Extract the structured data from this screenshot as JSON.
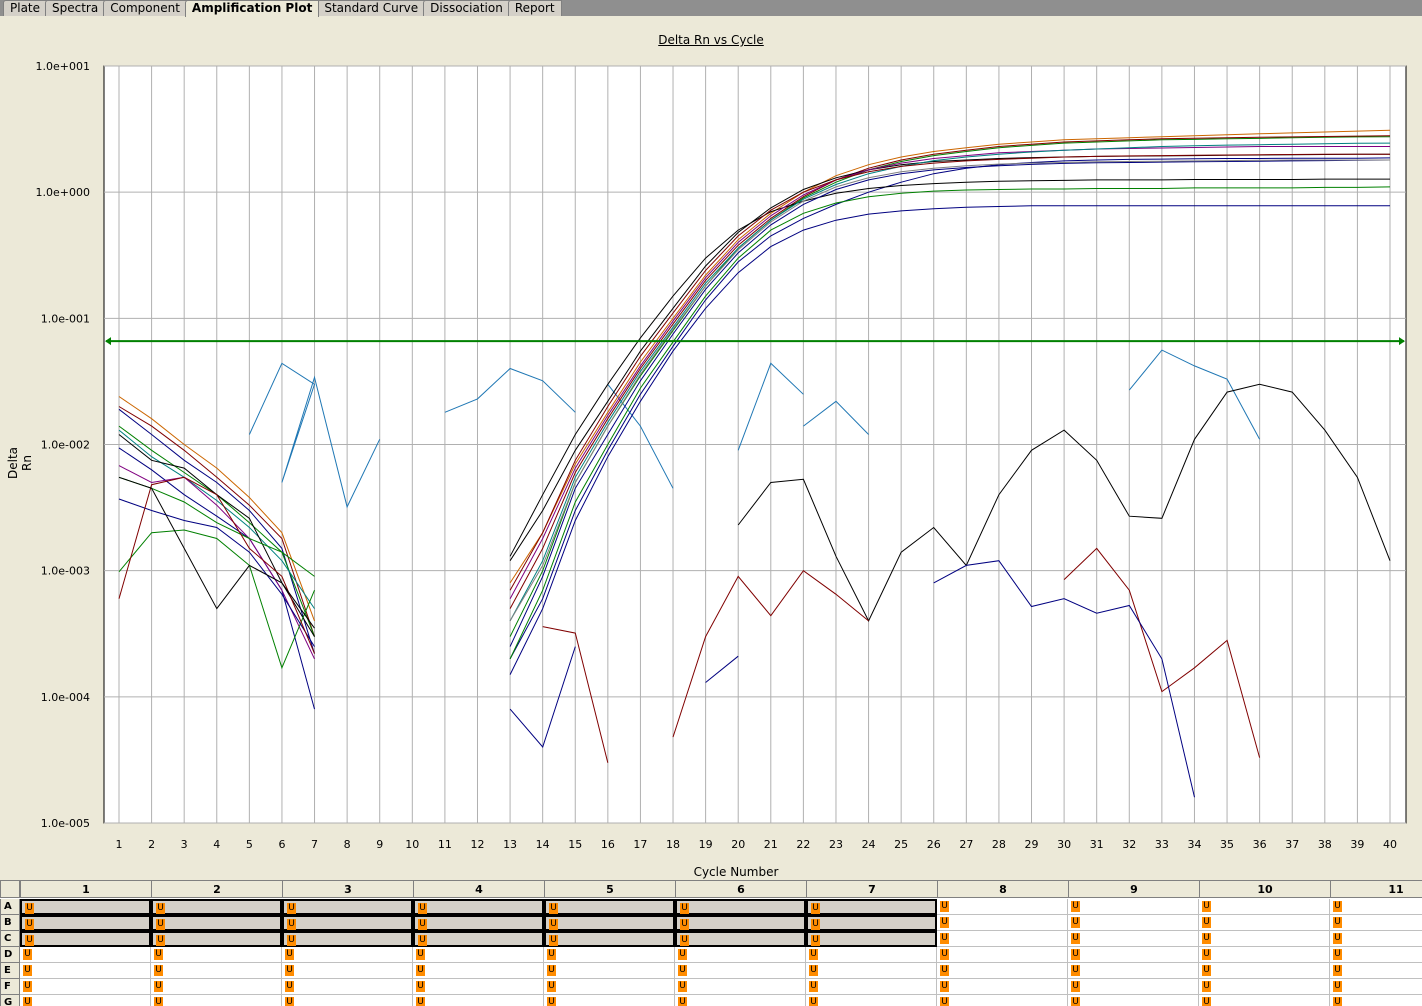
{
  "tabs": [
    "Plate",
    "Spectra",
    "Component",
    "Amplification Plot",
    "Standard Curve",
    "Dissociation",
    "Report"
  ],
  "active_tab": "Amplification Plot",
  "chart_data": {
    "type": "line",
    "title": "Delta Rn vs Cycle",
    "xlabel": "Cycle Number",
    "ylabel": "Delta Rn",
    "yscale": "log",
    "ylim": [
      1e-05,
      10
    ],
    "xlim": [
      1,
      40
    ],
    "y_tick_labels": [
      "1.0e+001",
      "1.0e+000",
      "1.0e-001",
      "1.0e-002",
      "1.0e-003",
      "1.0e-004",
      "1.0e-005"
    ],
    "x_tick_labels": [
      "1",
      "2",
      "3",
      "4",
      "5",
      "6",
      "7",
      "8",
      "9",
      "10",
      "11",
      "12",
      "13",
      "14",
      "15",
      "16",
      "17",
      "18",
      "19",
      "20",
      "21",
      "22",
      "23",
      "24",
      "25",
      "26",
      "27",
      "28",
      "29",
      "30",
      "31",
      "32",
      "33",
      "34",
      "35",
      "36",
      "37",
      "38",
      "39",
      "40"
    ],
    "grid": true,
    "threshold": 0.066,
    "threshold_color": "#008000",
    "amplification_curves": {
      "cycles": [
        13,
        14,
        15,
        16,
        17,
        18,
        19,
        20,
        21,
        22,
        23,
        24,
        25,
        26,
        27,
        28,
        29,
        30,
        31,
        32,
        33,
        34,
        35,
        36,
        37,
        38,
        39,
        40
      ],
      "series": [
        {
          "color": "#000080",
          "values": [
            0.0002,
            0.0006,
            0.003,
            0.009,
            0.025,
            0.06,
            0.14,
            0.28,
            0.45,
            0.62,
            0.8,
            1.0,
            1.2,
            1.4,
            1.55,
            1.65,
            1.72,
            1.77,
            1.8,
            1.82,
            1.83,
            1.84,
            1.85,
            1.85,
            1.86,
            1.86,
            1.86,
            1.87
          ]
        },
        {
          "color": "#000080",
          "values": [
            0.00015,
            0.0005,
            0.0025,
            0.008,
            0.022,
            0.055,
            0.12,
            0.23,
            0.37,
            0.5,
            0.6,
            0.67,
            0.71,
            0.74,
            0.76,
            0.77,
            0.78,
            0.78,
            0.78,
            0.78,
            0.78,
            0.78,
            0.78,
            0.78,
            0.78,
            0.78,
            0.78,
            0.78
          ]
        },
        {
          "color": "#008000",
          "values": [
            0.0002,
            0.0007,
            0.0035,
            0.01,
            0.028,
            0.065,
            0.15,
            0.3,
            0.5,
            0.68,
            0.82,
            0.92,
            0.98,
            1.02,
            1.04,
            1.05,
            1.06,
            1.06,
            1.07,
            1.07,
            1.07,
            1.08,
            1.08,
            1.08,
            1.08,
            1.09,
            1.09,
            1.1
          ]
        },
        {
          "color": "#008000",
          "values": [
            0.0003,
            0.001,
            0.005,
            0.014,
            0.035,
            0.08,
            0.18,
            0.36,
            0.6,
            0.9,
            1.2,
            1.5,
            1.75,
            1.95,
            2.1,
            2.25,
            2.35,
            2.45,
            2.5,
            2.55,
            2.6,
            2.62,
            2.65,
            2.67,
            2.7,
            2.72,
            2.74,
            2.75
          ]
        },
        {
          "color": "#800000",
          "values": [
            0.0005,
            0.0015,
            0.006,
            0.016,
            0.04,
            0.09,
            0.2,
            0.38,
            0.62,
            0.92,
            1.25,
            1.55,
            1.8,
            2.0,
            2.15,
            2.3,
            2.4,
            2.5,
            2.55,
            2.6,
            2.65,
            2.68,
            2.7,
            2.72,
            2.74,
            2.76,
            2.78,
            2.8
          ]
        },
        {
          "color": "#cc6600",
          "values": [
            0.0008,
            0.002,
            0.007,
            0.018,
            0.045,
            0.1,
            0.22,
            0.42,
            0.68,
            1.0,
            1.35,
            1.65,
            1.9,
            2.1,
            2.25,
            2.4,
            2.5,
            2.6,
            2.65,
            2.7,
            2.75,
            2.8,
            2.85,
            2.9,
            2.95,
            3.0,
            3.05,
            3.1
          ]
        },
        {
          "color": "#000000",
          "values": [
            0.0012,
            0.003,
            0.009,
            0.022,
            0.055,
            0.12,
            0.26,
            0.48,
            0.75,
            1.05,
            1.3,
            1.5,
            1.65,
            1.75,
            1.8,
            1.85,
            1.88,
            1.9,
            1.92,
            1.93,
            1.94,
            1.95,
            1.96,
            1.97,
            1.98,
            1.99,
            2.0,
            2.0
          ]
        },
        {
          "color": "#000000",
          "values": [
            0.0013,
            0.004,
            0.012,
            0.03,
            0.07,
            0.15,
            0.3,
            0.5,
            0.7,
            0.85,
            0.98,
            1.07,
            1.13,
            1.17,
            1.2,
            1.22,
            1.23,
            1.24,
            1.25,
            1.25,
            1.25,
            1.26,
            1.26,
            1.26,
            1.26,
            1.27,
            1.27,
            1.27
          ]
        },
        {
          "color": "#800080",
          "values": [
            0.0006,
            0.0018,
            0.0065,
            0.017,
            0.042,
            0.095,
            0.21,
            0.4,
            0.65,
            0.95,
            1.25,
            1.5,
            1.7,
            1.85,
            1.95,
            2.05,
            2.1,
            2.15,
            2.2,
            2.22,
            2.24,
            2.26,
            2.28,
            2.3,
            2.3,
            2.3,
            2.3,
            2.3
          ]
        },
        {
          "color": "#008080",
          "values": [
            0.0004,
            0.0012,
            0.0055,
            0.015,
            0.038,
            0.085,
            0.19,
            0.36,
            0.6,
            0.88,
            1.15,
            1.4,
            1.6,
            1.78,
            1.9,
            2.0,
            2.08,
            2.15,
            2.2,
            2.25,
            2.3,
            2.33,
            2.36,
            2.38,
            2.4,
            2.42,
            2.44,
            2.45
          ]
        },
        {
          "color": "#000080",
          "values": [
            0.00025,
            0.0009,
            0.0045,
            0.012,
            0.032,
            0.075,
            0.17,
            0.33,
            0.55,
            0.8,
            1.05,
            1.25,
            1.4,
            1.5,
            1.57,
            1.62,
            1.66,
            1.69,
            1.71,
            1.72,
            1.73,
            1.74,
            1.75,
            1.76,
            1.77,
            1.78,
            1.79,
            1.8
          ]
        },
        {
          "color": "#800000",
          "values": [
            0.0007,
            0.002,
            0.0075,
            0.02,
            0.05,
            0.11,
            0.24,
            0.45,
            0.72,
            1.0,
            1.25,
            1.45,
            1.6,
            1.7,
            1.77,
            1.82,
            1.86,
            1.9,
            1.92,
            1.94,
            1.95,
            1.96,
            1.97,
            1.98,
            1.99,
            2.0,
            2.0,
            2.0
          ]
        },
        {
          "color": "#808080",
          "values": [
            0.0004,
            0.0011,
            0.005,
            0.014,
            0.036,
            0.082,
            0.18,
            0.35,
            0.58,
            0.85,
            1.1,
            1.3,
            1.45,
            1.55,
            1.62,
            1.67,
            1.7,
            1.72,
            1.74,
            1.75,
            1.76,
            1.77,
            1.78,
            1.79,
            1.8,
            1.8,
            1.8,
            1.8
          ]
        }
      ]
    },
    "noise_traces": [
      {
        "color": "#1f77b4",
        "points": [
          [
            5,
            0.012
          ],
          [
            6,
            0.044
          ],
          [
            7,
            0.03
          ],
          [
            6,
            0.005
          ],
          [
            7,
            0.034
          ],
          [
            8,
            0.0032
          ],
          [
            9,
            0.011
          ]
        ]
      },
      {
        "color": "#1f77b4",
        "points": [
          [
            11,
            0.018
          ],
          [
            12,
            0.023
          ],
          [
            13,
            0.04
          ],
          [
            14,
            0.032
          ],
          [
            15,
            0.018
          ]
        ]
      },
      {
        "color": "#1f77b4",
        "points": [
          [
            16,
            0.03
          ],
          [
            17,
            0.014
          ],
          [
            18,
            0.0045
          ]
        ]
      },
      {
        "color": "#1f77b4",
        "points": [
          [
            20,
            0.009
          ],
          [
            21,
            0.044
          ],
          [
            22,
            0.025
          ]
        ]
      },
      {
        "color": "#1f77b4",
        "points": [
          [
            22,
            0.014
          ],
          [
            23,
            0.022
          ],
          [
            24,
            0.012
          ]
        ]
      },
      {
        "color": "#1f77b4",
        "points": [
          [
            32,
            0.027
          ],
          [
            33,
            0.056
          ],
          [
            34,
            0.042
          ],
          [
            35,
            0.033
          ],
          [
            36,
            0.011
          ]
        ]
      },
      {
        "color": "#000000",
        "points": [
          [
            20,
            0.0023
          ],
          [
            21,
            0.005
          ],
          [
            22,
            0.0053
          ],
          [
            23,
            0.0013
          ],
          [
            24,
            0.0004
          ],
          [
            25,
            0.0014
          ],
          [
            26,
            0.0022
          ],
          [
            27,
            0.0011
          ],
          [
            28,
            0.004
          ],
          [
            29,
            0.009
          ],
          [
            30,
            0.013
          ],
          [
            31,
            0.0075
          ],
          [
            32,
            0.0027
          ],
          [
            33,
            0.0026
          ],
          [
            34,
            0.011
          ],
          [
            35,
            0.026
          ],
          [
            36,
            0.03
          ],
          [
            37,
            0.026
          ],
          [
            38,
            0.013
          ],
          [
            39,
            0.0055
          ],
          [
            40,
            0.0012
          ]
        ]
      },
      {
        "color": "#800000",
        "points": [
          [
            18,
            4.8e-05
          ],
          [
            19,
            0.0003
          ],
          [
            20,
            0.0009
          ],
          [
            21,
            0.00044
          ],
          [
            22,
            0.001
          ],
          [
            23,
            0.00065
          ],
          [
            24,
            0.0004
          ]
        ]
      },
      {
        "color": "#800000",
        "points": [
          [
            30,
            0.00085
          ],
          [
            31,
            0.0015
          ],
          [
            32,
            0.0007
          ],
          [
            33,
            0.00011
          ],
          [
            34,
            0.00017
          ],
          [
            35,
            0.00028
          ],
          [
            36,
            3.3e-05
          ]
        ]
      },
      {
        "color": "#800000",
        "points": [
          [
            14,
            0.00036
          ],
          [
            15,
            0.00032
          ],
          [
            16,
            3e-05
          ]
        ]
      },
      {
        "color": "#000080",
        "points": [
          [
            26,
            0.0008
          ],
          [
            27,
            0.0011
          ],
          [
            28,
            0.0012
          ],
          [
            29,
            0.00052
          ],
          [
            30,
            0.0006
          ],
          [
            31,
            0.00046
          ],
          [
            32,
            0.00053
          ],
          [
            33,
            0.0002
          ],
          [
            34,
            1.6e-05
          ]
        ]
      },
      {
        "color": "#000080",
        "points": [
          [
            19,
            0.00013
          ],
          [
            20,
            0.00021
          ]
        ]
      },
      {
        "color": "#000080",
        "points": [
          [
            13,
            8e-05
          ],
          [
            14,
            4e-05
          ],
          [
            15,
            0.00025
          ]
        ]
      }
    ],
    "early_cycle_traces": [
      {
        "color": "#cc6600",
        "values": [
          0.024,
          0.016,
          0.01,
          0.0065,
          0.0038,
          0.002,
          0.0004
        ]
      },
      {
        "color": "#800000",
        "values": [
          0.02,
          0.014,
          0.009,
          0.0055,
          0.0033,
          0.0018,
          0.0003
        ]
      },
      {
        "color": "#000080",
        "values": [
          0.019,
          0.012,
          0.0075,
          0.005,
          0.003,
          0.0015,
          0.00022
        ]
      },
      {
        "color": "#008000",
        "values": [
          0.014,
          0.009,
          0.006,
          0.004,
          0.0024,
          0.0014,
          0.0003
        ]
      },
      {
        "color": "#008080",
        "values": [
          0.013,
          0.008,
          0.0055,
          0.0036,
          0.0022,
          0.0012,
          0.0005
        ]
      },
      {
        "color": "#000000",
        "values": [
          0.012,
          0.0075,
          0.0065,
          0.004,
          0.0026,
          0.0008,
          0.0003
        ]
      },
      {
        "color": "#000080",
        "values": [
          0.0094,
          0.0063,
          0.004,
          0.0027,
          0.0018,
          0.0007,
          8e-05
        ]
      },
      {
        "color": "#800080",
        "values": [
          0.0068,
          0.005,
          0.0055,
          0.0033,
          0.0018,
          0.0007,
          0.0002
        ]
      },
      {
        "color": "#008000",
        "values": [
          0.00098,
          0.002,
          0.0021,
          0.0018,
          0.0011,
          0.00017,
          0.0007
        ]
      },
      {
        "color": "#008000",
        "values": [
          0.0055,
          0.0045,
          0.0035,
          0.0024,
          0.0018,
          0.0014,
          0.0009
        ]
      },
      {
        "color": "#000080",
        "values": [
          0.0037,
          0.003,
          0.0025,
          0.0022,
          0.0014,
          0.00065,
          0.00025
        ]
      },
      {
        "color": "#800000",
        "values": [
          0.0006,
          0.0048,
          0.0055,
          0.004,
          0.0015,
          0.0009,
          0.00022
        ]
      },
      {
        "color": "#000000",
        "values": [
          0.0055,
          0.0045,
          0.0015,
          0.0005,
          0.0011,
          0.0008,
          0.00035
        ]
      }
    ]
  },
  "plate": {
    "columns": [
      "1",
      "2",
      "3",
      "4",
      "5",
      "6",
      "7",
      "8",
      "9",
      "10",
      "11"
    ],
    "rows": [
      "A",
      "B",
      "C",
      "D",
      "E",
      "F",
      "G"
    ],
    "well_marker": "U",
    "selected_rows": [
      "A",
      "B",
      "C"
    ],
    "selected_columns": [
      "1",
      "2",
      "3",
      "4",
      "5",
      "6",
      "7"
    ]
  }
}
